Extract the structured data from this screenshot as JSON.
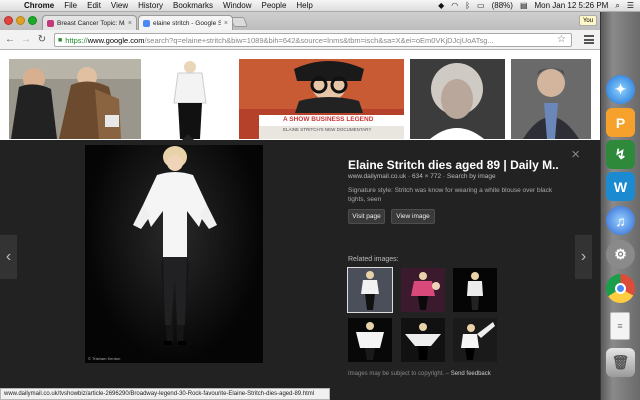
{
  "menubar": {
    "app": "Chrome",
    "items": [
      "File",
      "Edit",
      "View",
      "History",
      "Bookmarks",
      "Window",
      "People",
      "Help"
    ],
    "battery": "(88%)",
    "clock": "Mon Jan 12  5:26 PM"
  },
  "tabs": [
    {
      "title": "Breast Cancer Topic: Mayo",
      "active": false
    },
    {
      "title": "elaine stritch - Google Se",
      "active": true
    }
  ],
  "profile_badge": "You",
  "address": {
    "scheme": "https://",
    "host": "www.google.com",
    "path": "/search?q=elaine+stritch&biw=1089&bih=642&source=lnms&tbm=isch&sa=X&ei=oEm0VKjDJcjUoATsg..."
  },
  "thumbnail_captions": {
    "banner_main": "A SHOW BUSINESS LEGEND",
    "banner_sub": "ELAINE STRITCH'S NEW DOCUMENTARY"
  },
  "viewer": {
    "title": "Elaine Stritch dies aged 89 | Daily M...",
    "domain": "www.dailymail.co.uk",
    "dims": "634 × 772",
    "search_by_image": "Search by image",
    "description": "Signature style: Stritch was know for wearing a white blouse over black tights, seen",
    "visit_page": "Visit page",
    "view_image": "View image",
    "related_label": "Related images:",
    "copyright": "Images may be subject to copyright.",
    "feedback": "Send feedback",
    "photo_credit": "© Tristram Kenton",
    "prev_glyph": "‹",
    "next_glyph": "›",
    "close_glyph": "×"
  },
  "status_url": "www.dailymail.co.uk/tvshowbiz/article-2696290/Broadway-legend-30-Rock-favourite-Elaine-Stritch-dies-aged-89.html",
  "dock": [
    "safari-icon",
    "pages-icon",
    "sigil-icon",
    "word-icon",
    "itunes-icon",
    "system-preferences-icon",
    "chrome-icon",
    "document-icon",
    "trash-icon"
  ],
  "colors": {
    "panel_bg": "#222222",
    "https_green": "#1d8c2c",
    "dock_chrome": "#dd4b39"
  }
}
